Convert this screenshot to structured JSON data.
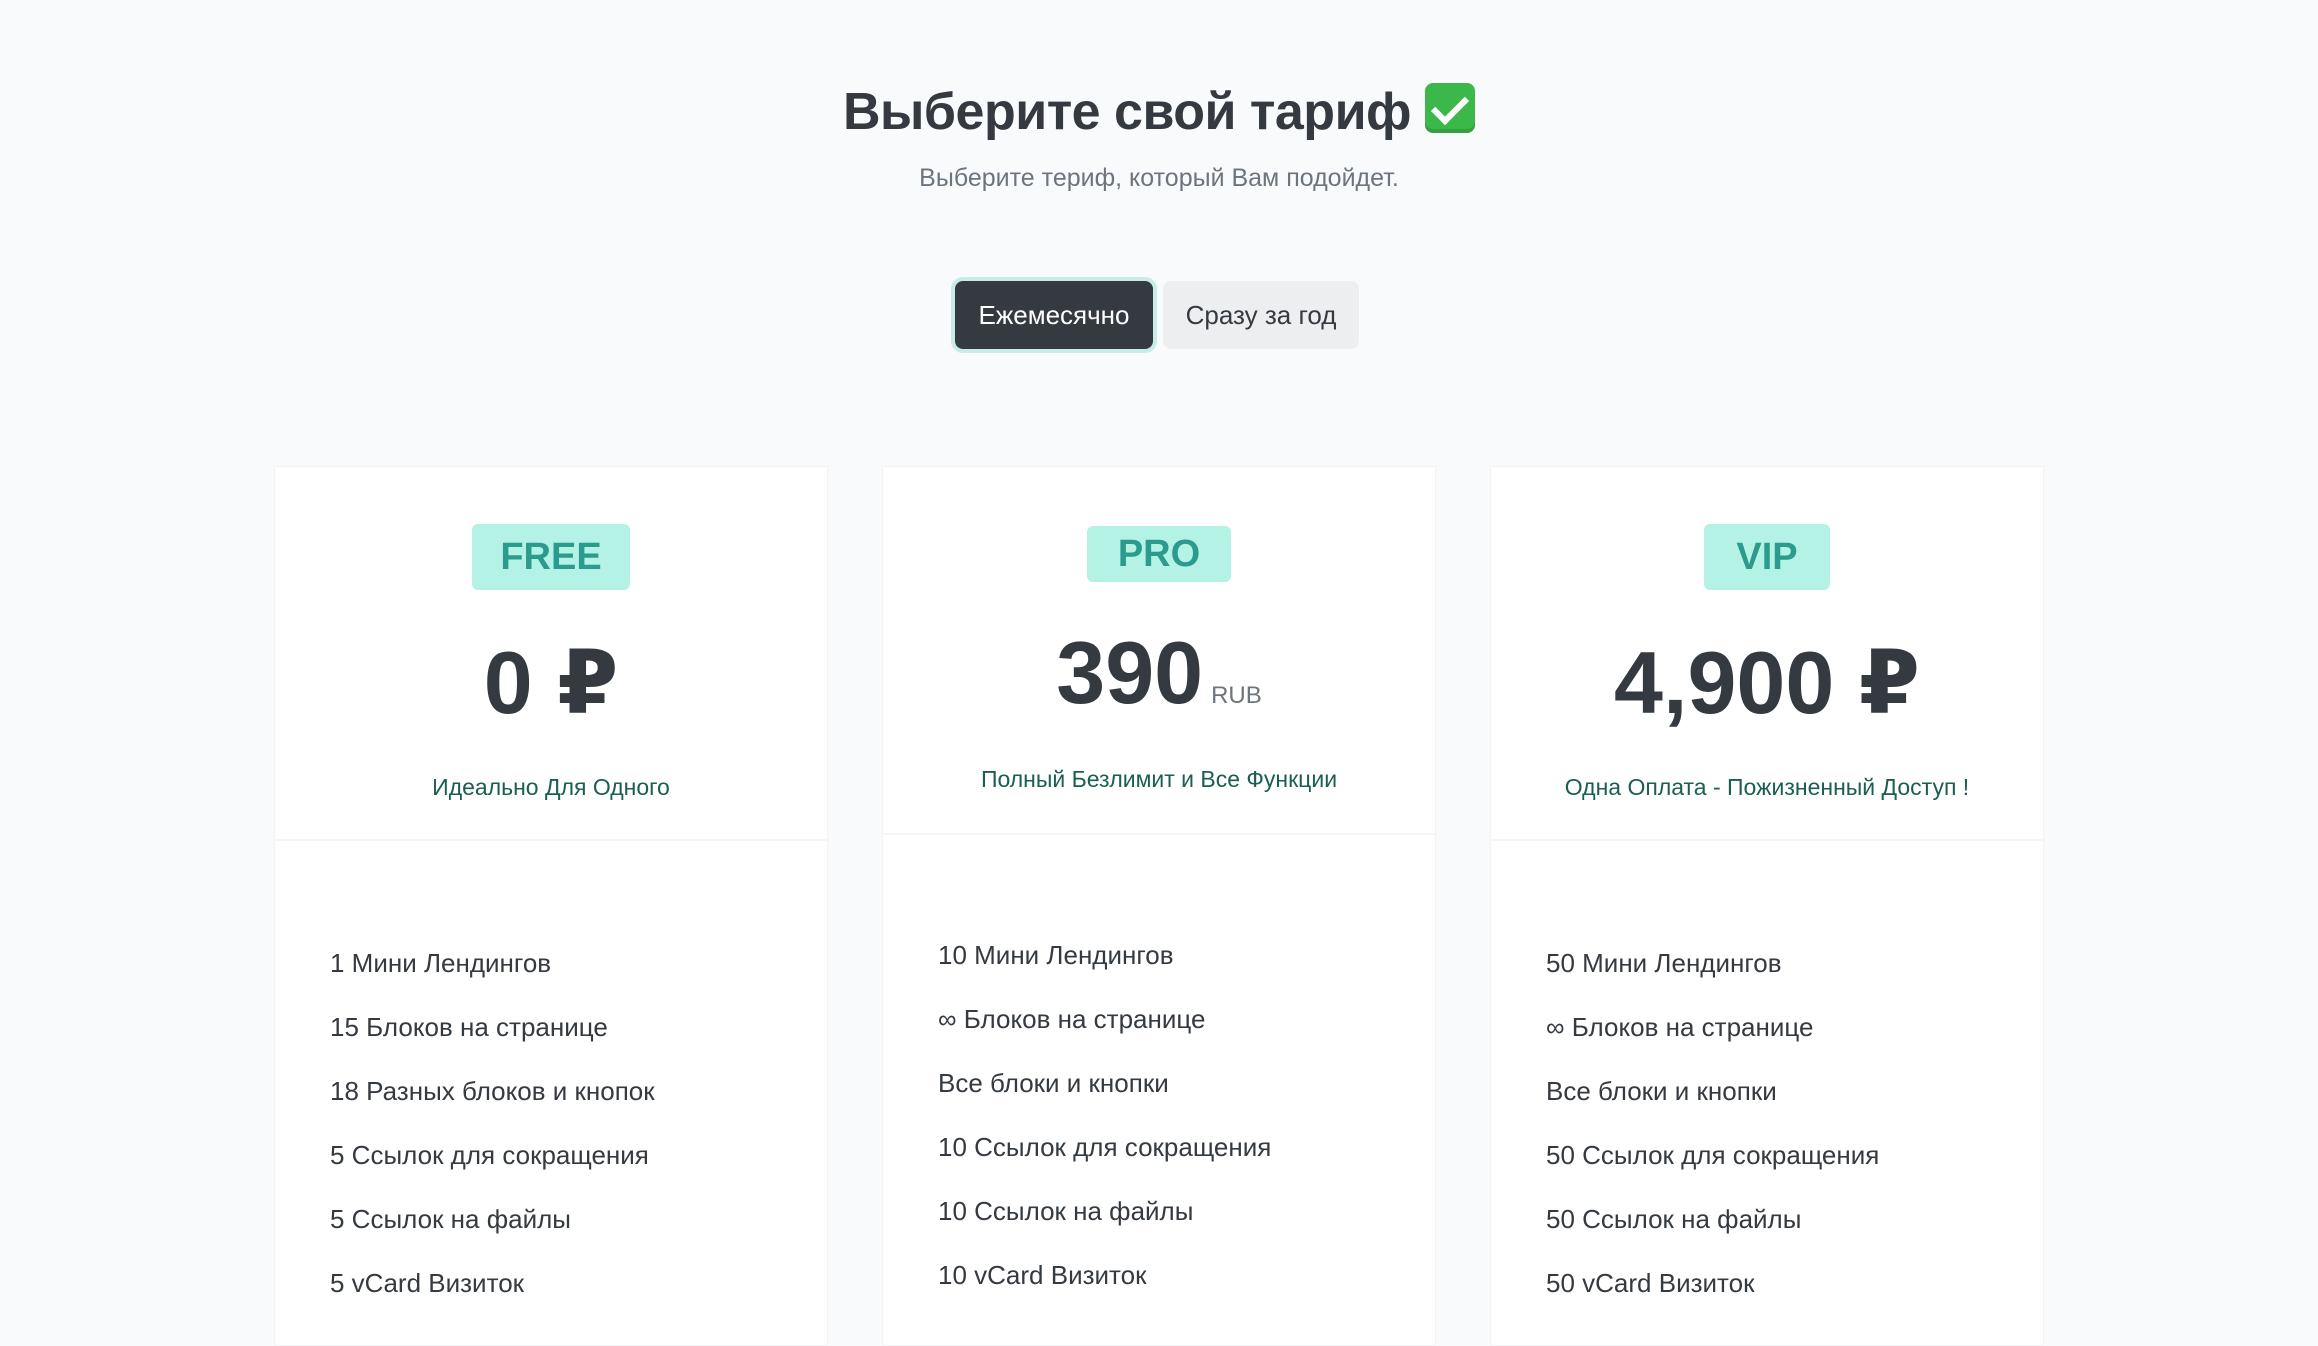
{
  "header": {
    "title": "Выберите свой тариф",
    "subtitle": "Выберите териф, который Вам подойдет."
  },
  "billing_toggle": {
    "options": [
      {
        "label": "Ежемесячно",
        "selected": true
      },
      {
        "label": "Сразу за год",
        "selected": false
      }
    ]
  },
  "plans": [
    {
      "name": "FREE",
      "price": "0 ₽",
      "tagline": "Идеально Для Одного",
      "features": [
        "1 Мини Лендингов",
        "15 Блоков на странице",
        "18 Разных блоков и кнопок",
        "5 Ссылок для сокращения",
        "5 Ссылок на файлы",
        "5 vCard Визиток"
      ]
    },
    {
      "name": "PRO",
      "price": "390",
      "price_unit": "RUB",
      "tagline": "Полный Безлимит и Все Функции",
      "features": [
        "10 Мини Лендингов",
        "∞ Блоков на странице",
        "Все блоки и кнопки",
        "10 Ссылок для сокращения",
        "10 Ссылок на файлы",
        "10 vCard Визиток"
      ]
    },
    {
      "name": "VIP",
      "price": "4,900 ₽",
      "tagline": "Одна Оплата - Пожизненный Доступ !",
      "features": [
        "50 Мини Лендингов",
        "∞ Блоков на странице",
        "Все блоки и кнопки",
        "50 Ссылок для сокращения",
        "50 Ссылок на файлы",
        "50 vCard Визиток"
      ]
    }
  ],
  "colors": {
    "badge_bg": "#b5f2e6",
    "badge_text": "#2b9b8d",
    "toggle_active_bg": "#343a40",
    "tagline_text": "#1b5e52",
    "check_icon": "#3cb84a"
  },
  "icons": {
    "title_icon": "check-mark-button-icon"
  }
}
